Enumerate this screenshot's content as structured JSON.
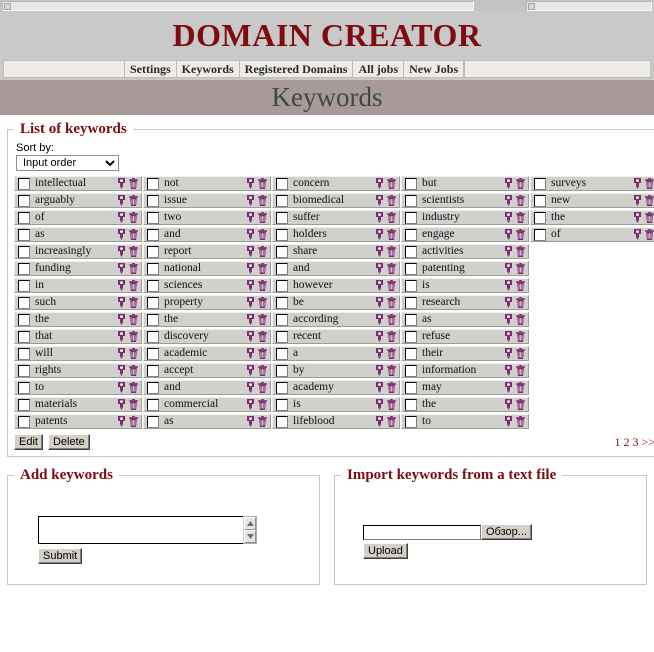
{
  "app": {
    "brand_title": "DOMAIN CREATOR",
    "page_title": "Keywords"
  },
  "nav": {
    "items": [
      {
        "label": "Settings"
      },
      {
        "label": "Keywords"
      },
      {
        "label": "Registered Domains"
      },
      {
        "label": "All jobs"
      },
      {
        "label": "New Jobs"
      }
    ]
  },
  "keywords_panel": {
    "legend": "List of keywords",
    "sort_label": "Sort by:",
    "sort_value": "Input order",
    "sort_options": [
      "Input order"
    ],
    "edit_button": "Edit",
    "delete_button": "Delete",
    "edit_icon_title": "edit",
    "delete_icon_title": "delete",
    "pagination": [
      "1",
      "2",
      "3",
      ">>"
    ],
    "columns": [
      {
        "items": [
          "intellectual",
          "arguably",
          "of",
          "as",
          "increasingly",
          "funding",
          "in",
          "such",
          "the",
          "that",
          "will",
          "rights",
          "to",
          "materials",
          "patents"
        ]
      },
      {
        "items": [
          "not",
          "issue",
          "two",
          "and",
          "report",
          "national",
          "sciences",
          "property",
          "the",
          "discovery",
          "academic",
          "accept",
          "and",
          "commercial",
          "as"
        ]
      },
      {
        "items": [
          "concern",
          "biomedical",
          "suffer",
          "holders",
          "share",
          "and",
          "however",
          "be",
          "according",
          "recent",
          "a",
          "by",
          "academy",
          "is",
          "lifeblood"
        ]
      },
      {
        "items": [
          "but",
          "scientists",
          "industry",
          "engage",
          "activities",
          "patenting",
          "is",
          "research",
          "as",
          "refuse",
          "their",
          "information",
          "may",
          "the",
          "to"
        ]
      },
      {
        "items": [
          "surveys",
          "new",
          "the",
          "of"
        ]
      }
    ]
  },
  "add_panel": {
    "legend": "Add keywords",
    "textarea_value": "",
    "textarea_placeholder": "",
    "submit_label": "Submit"
  },
  "import_panel": {
    "legend": "Import keywords from a text file",
    "file_value": "",
    "browse_label": "Обзор...",
    "upload_label": "Upload"
  },
  "colors": {
    "brand": "#7e0b10",
    "banner": "#a99a9a",
    "page_title": "#3d4a42",
    "header_bg": "#c9c9c9",
    "row_bg": "#d2d0cd",
    "icon": "#7a2d6b"
  }
}
